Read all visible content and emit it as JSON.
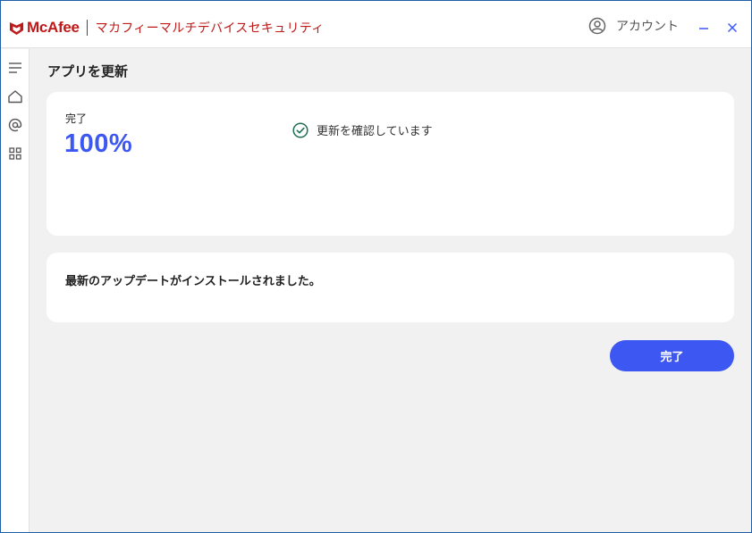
{
  "header": {
    "brand_name": "McAfee",
    "product_name": "マカフィーマルチデバイスセキュリティ",
    "account_label": "アカウント",
    "minimize_icon": "minimize-icon",
    "close_icon": "close-icon"
  },
  "sidebar": {
    "items": [
      {
        "icon": "menu-icon"
      },
      {
        "icon": "home-icon"
      },
      {
        "icon": "identity-icon"
      },
      {
        "icon": "apps-grid-icon"
      }
    ]
  },
  "main": {
    "page_title": "アプリを更新",
    "progress": {
      "status_label": "完了",
      "percent_text": "100%",
      "percent_value": 100,
      "check_icon": "check-circle-icon",
      "check_text": "更新を確認しています"
    },
    "message": "最新のアップデートがインストールされました。",
    "done_button": "完了"
  },
  "colors": {
    "brand_red": "#c01818",
    "accent_blue": "#3d57f2",
    "check_green": "#1e6e52",
    "background": "#f1f1f1",
    "card": "#ffffff"
  }
}
